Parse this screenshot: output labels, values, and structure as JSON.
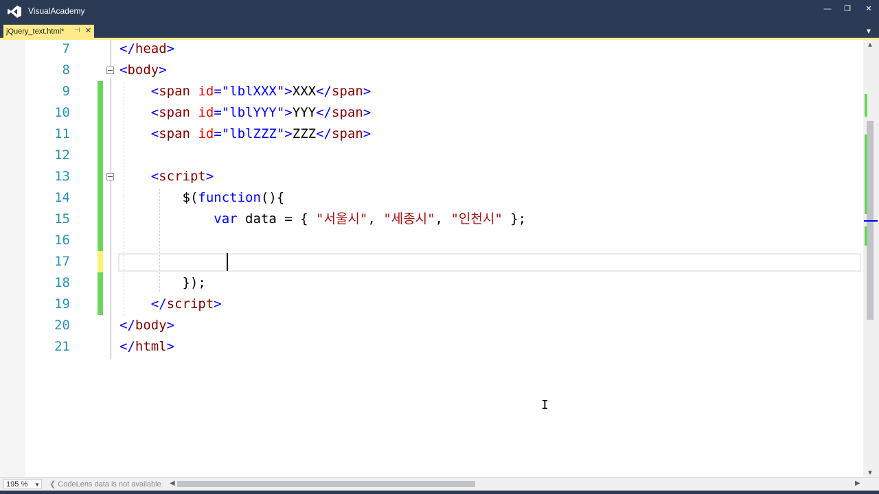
{
  "window": {
    "title": "VisualAcademy",
    "controls": {
      "minimize": "—",
      "restore": "❐",
      "close": "✕"
    }
  },
  "tab": {
    "label": "jQuery_text.html*",
    "pin": "⊣",
    "close": "✕"
  },
  "editor": {
    "lines": [
      {
        "num": "7"
      },
      {
        "num": "8"
      },
      {
        "num": "9"
      },
      {
        "num": "10"
      },
      {
        "num": "11"
      },
      {
        "num": "12"
      },
      {
        "num": "13"
      },
      {
        "num": "14"
      },
      {
        "num": "15"
      },
      {
        "num": "16"
      },
      {
        "num": "17"
      },
      {
        "num": "18"
      },
      {
        "num": "19"
      },
      {
        "num": "20"
      },
      {
        "num": "21"
      }
    ],
    "code": {
      "l7": "head",
      "l8": "body",
      "span_tag": "span",
      "id_attr": "id",
      "l9_val": "\"lblXXX\"",
      "l9_text": "XXX",
      "l10_val": "\"lblYYY\"",
      "l10_text": "YYY",
      "l11_val": "\"lblZZZ\"",
      "l11_text": "ZZZ",
      "script_tag": "script",
      "l14_dollar": "$(",
      "l14_fn": "function",
      "l14_rest": "(){",
      "l15_var": "var",
      "l15_mid": " data = { ",
      "l15_s1": "\"서울시\"",
      "l15_s2": "\"세종시\"",
      "l15_s3": "\"인천시\"",
      "l15_end": " };",
      "l18": "});",
      "l20": "body",
      "l21": "html"
    }
  },
  "status": {
    "zoom": "195 %",
    "codelens": "CodeLens data is not available"
  },
  "colors": {
    "titlebar": "#2b3a55",
    "tab_active": "#ffeb8b",
    "line_number": "#2b91af",
    "tag": "#800000",
    "attribute": "#ff0000",
    "attr_value": "#0000ff",
    "string": "#a31515",
    "keyword": "#0000ff",
    "change_saved": "#6bd65b",
    "change_unsaved": "#fff176"
  }
}
